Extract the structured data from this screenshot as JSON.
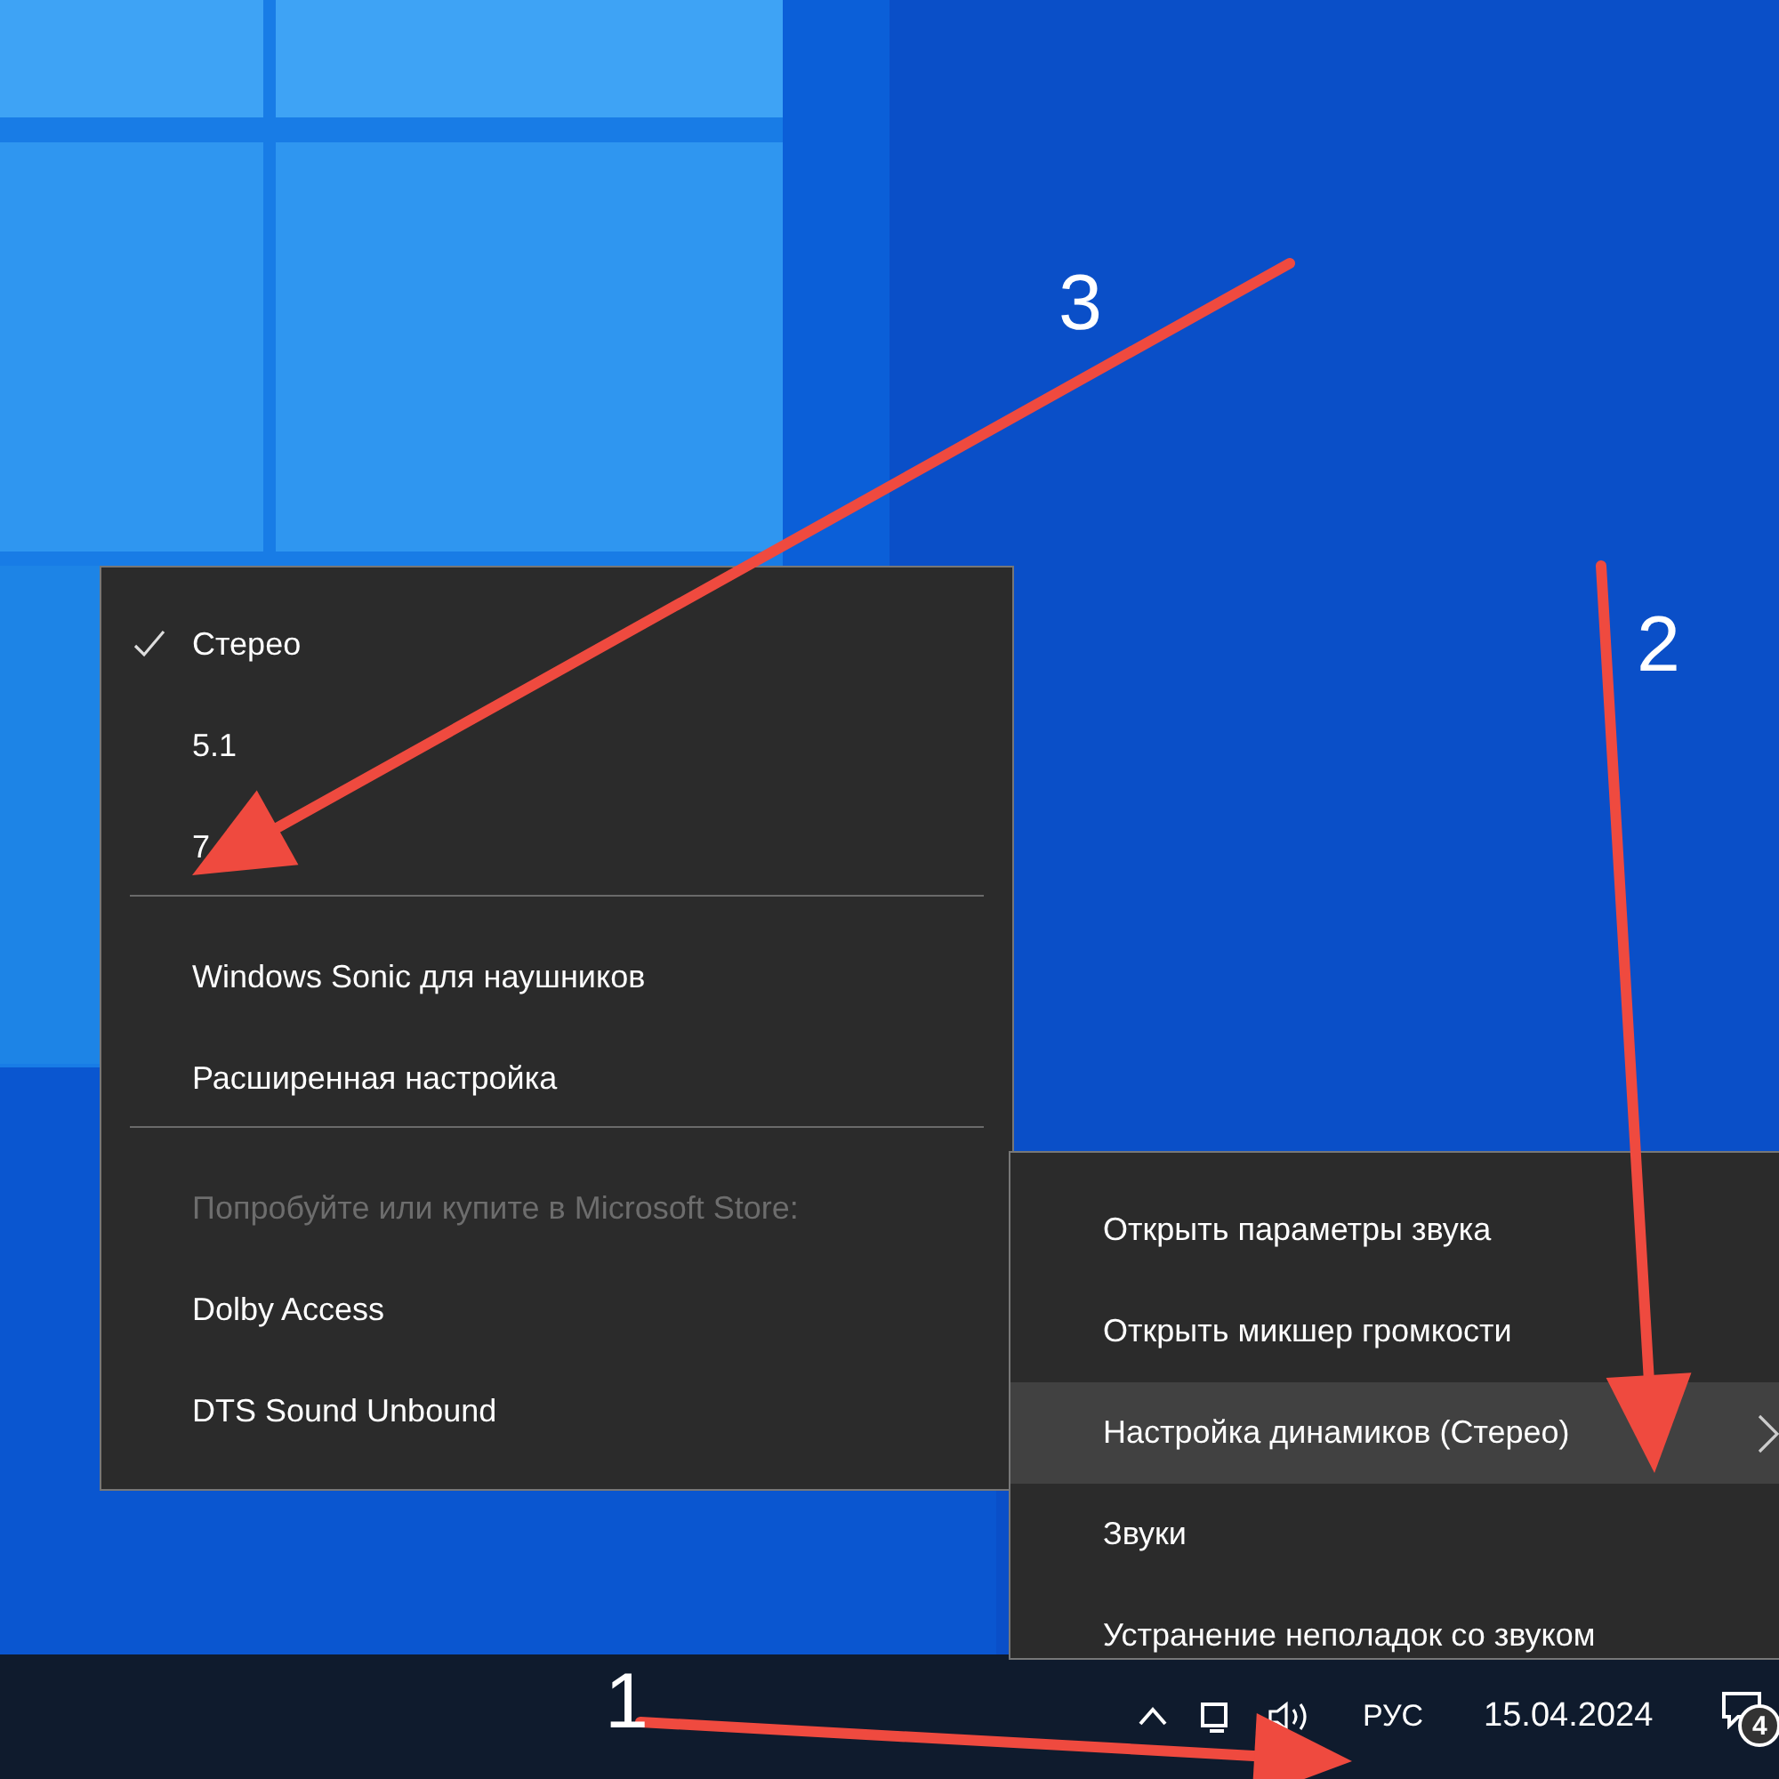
{
  "speaker_menu": {
    "items": [
      {
        "kind": "option",
        "label": "Стерео",
        "checked": true
      },
      {
        "kind": "option",
        "label": "5.1",
        "checked": false
      },
      {
        "kind": "option",
        "label": "7",
        "checked": false
      },
      {
        "kind": "separator"
      },
      {
        "kind": "item",
        "label": "Windows Sonic для наушников"
      },
      {
        "kind": "item",
        "label": "Расширенная настройка"
      },
      {
        "kind": "separator"
      },
      {
        "kind": "header",
        "label": "Попробуйте или купите в Microsoft Store:",
        "disabled": true
      },
      {
        "kind": "item",
        "label": "Dolby Access"
      },
      {
        "kind": "item",
        "label": "DTS Sound Unbound"
      }
    ]
  },
  "context_menu": {
    "items": [
      {
        "label": "Открыть параметры звука",
        "selected": false,
        "submenu": false
      },
      {
        "label": "Открыть микшер громкости",
        "selected": false,
        "submenu": false
      },
      {
        "label": "Настройка динамиков (Стерео)",
        "selected": true,
        "submenu": true
      },
      {
        "label": "Звуки",
        "selected": false,
        "submenu": false
      },
      {
        "label": "Устранение неполадок со звуком",
        "selected": false,
        "submenu": false
      }
    ]
  },
  "taskbar": {
    "language": "РУС",
    "date": "15.04.2024",
    "notification_count": "4"
  },
  "annotations": [
    {
      "label": "1"
    },
    {
      "label": "2"
    },
    {
      "label": "3"
    }
  ]
}
